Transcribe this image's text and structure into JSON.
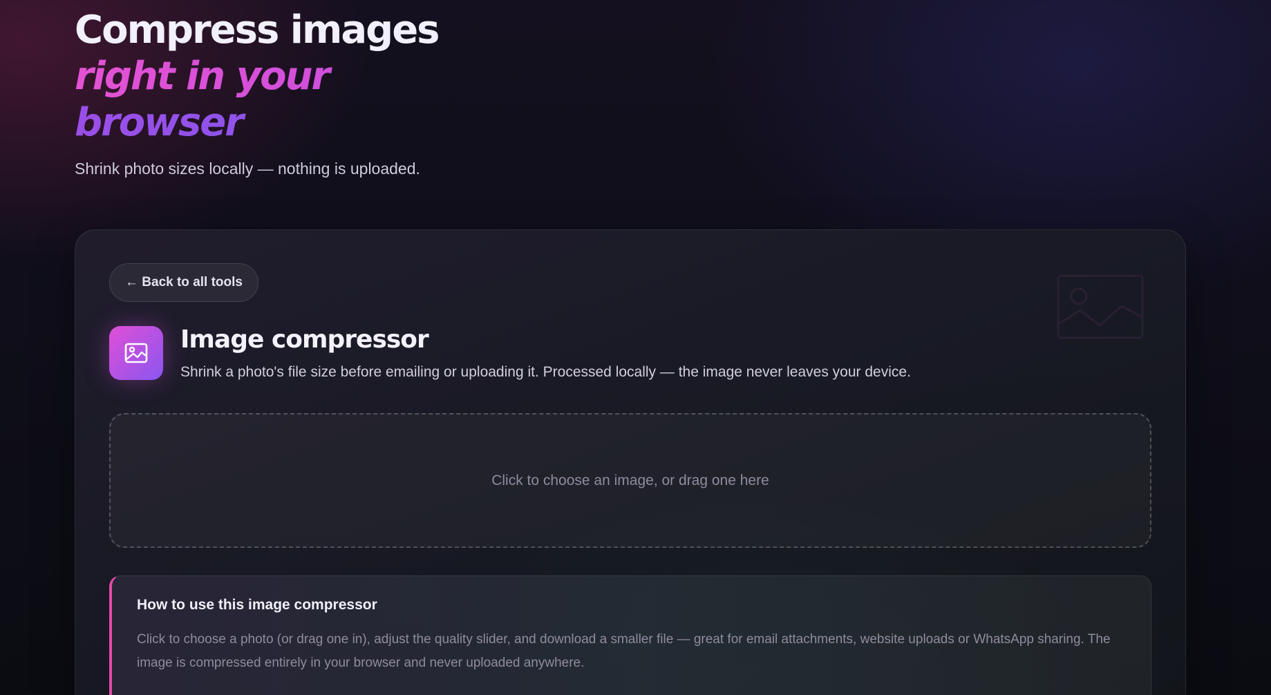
{
  "hero": {
    "title_line1": "Compress images",
    "title_line2": "right in your",
    "title_line3": "browser",
    "subtitle": "Shrink photo sizes locally — nothing is uploaded."
  },
  "tool": {
    "back_label": "← Back to all tools",
    "title": "Image compressor",
    "description": "Shrink a photo's file size before emailing or uploading it. Processed locally — the image never leaves your device.",
    "icon": "image-icon"
  },
  "dropzone": {
    "text": "Click to choose an image, or drag one here"
  },
  "howto": {
    "title": "How to use this image compressor",
    "text": "Click to choose a photo (or drag one in), adjust the quality slider, and download a smaller file — great for email attachments, website uploads or WhatsApp sharing. The image is compressed entirely in your browser and never uploaded anywhere."
  },
  "colors": {
    "accent_pink": "#e452d4",
    "accent_violet": "#6f63f0",
    "howto_border": "#e64aa8",
    "background": "#0f0e1a"
  }
}
